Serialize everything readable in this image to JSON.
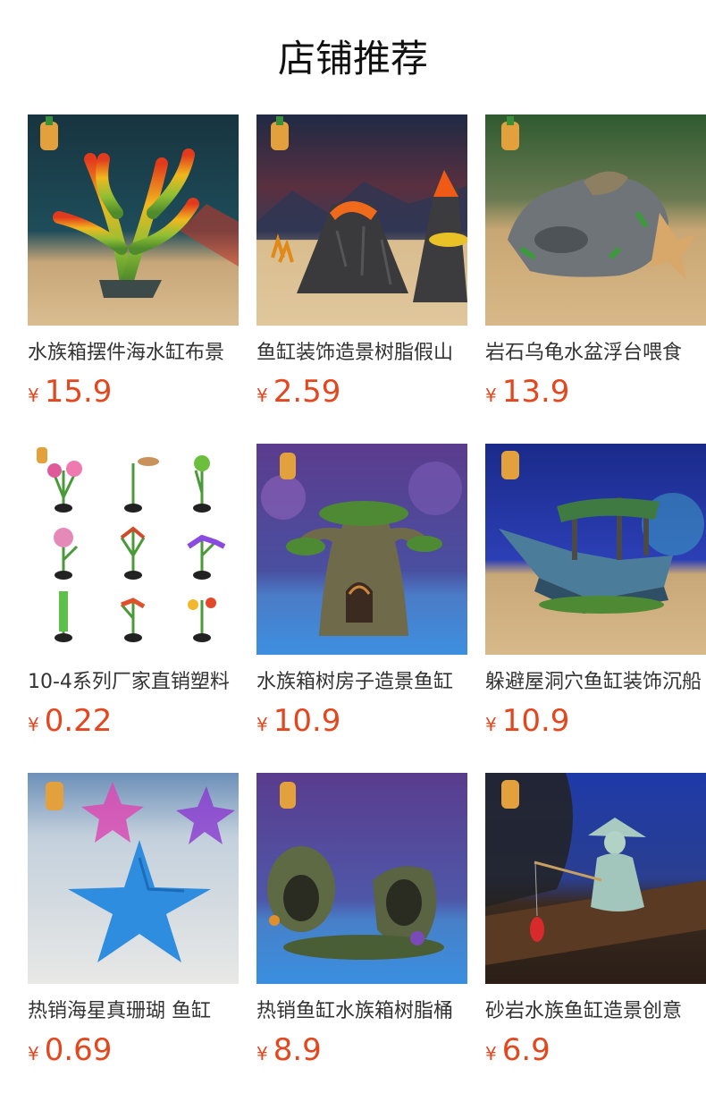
{
  "header": {
    "title": "店铺推荐"
  },
  "products": [
    {
      "name": "水族箱摆件海水缸布景",
      "currency": "¥",
      "price": "15.9",
      "image": "coral-ornament"
    },
    {
      "name": "鱼缸装饰造景树脂假山",
      "currency": "¥",
      "price": "2.59",
      "image": "volcano-ornament"
    },
    {
      "name": "岩石乌龟水盆浮台喂食",
      "currency": "¥",
      "price": "13.9",
      "image": "rock-turtle-basin"
    },
    {
      "name": "10-4系列厂家直销塑料",
      "currency": "¥",
      "price": "0.22",
      "image": "plastic-plants-set"
    },
    {
      "name": "水族箱树房子造景鱼缸",
      "currency": "¥",
      "price": "10.9",
      "image": "tree-house-ornament"
    },
    {
      "name": "躲避屋洞穴鱼缸装饰沉船",
      "currency": "¥",
      "price": "10.9",
      "image": "shipwreck-ornament"
    },
    {
      "name": "热销海星真珊瑚 鱼缸",
      "currency": "¥",
      "price": "0.69",
      "image": "starfish"
    },
    {
      "name": "热销鱼缸水族箱树脂桶",
      "currency": "¥",
      "price": "8.9",
      "image": "barrel-ornament"
    },
    {
      "name": "砂岩水族鱼缸造景创意",
      "currency": "¥",
      "price": "6.9",
      "image": "fisherman-figurine"
    }
  ],
  "colors": {
    "price": "#e4461d",
    "title": "#111111",
    "name": "#333333"
  }
}
